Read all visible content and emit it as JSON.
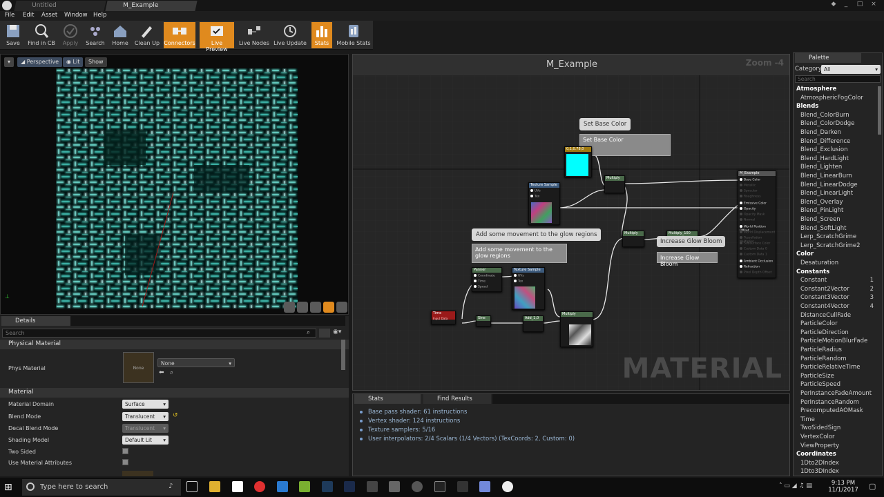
{
  "titlebar": {
    "tabs": [
      "Untitled",
      "M_Example"
    ],
    "controls": [
      "_",
      "□",
      "×"
    ]
  },
  "menu": [
    "File",
    "Edit",
    "Asset",
    "Window",
    "Help"
  ],
  "toolbar": [
    {
      "label": "Save",
      "state": "normal",
      "icon": "save-icon"
    },
    {
      "label": "Find in CB",
      "state": "normal",
      "icon": "find-in-cb-icon"
    },
    {
      "label": "Apply",
      "state": "disabled",
      "icon": "apply-icon"
    },
    {
      "label": "Search",
      "state": "normal",
      "icon": "search-icon"
    },
    {
      "label": "Home",
      "state": "normal",
      "icon": "home-icon"
    },
    {
      "label": "Clean Up",
      "state": "normal",
      "icon": "clean-up-icon"
    },
    {
      "label": "Connectors",
      "state": "active",
      "icon": "connectors-icon"
    },
    {
      "label": "Live Preview",
      "state": "active",
      "icon": "live-preview-icon"
    },
    {
      "label": "Live Nodes",
      "state": "normal",
      "icon": "live-nodes-icon"
    },
    {
      "label": "Live Update",
      "state": "normal",
      "icon": "live-update-icon"
    },
    {
      "label": "Stats",
      "state": "active",
      "icon": "stats-icon"
    },
    {
      "label": "Mobile Stats",
      "state": "normal",
      "icon": "mobile-stats-icon"
    }
  ],
  "viewport": {
    "perspective": "Perspective",
    "lit": "Lit",
    "show": "Show"
  },
  "details": {
    "tab": "Details",
    "search_placeholder": "Search",
    "physical_material_section": "Physical Material",
    "phys_material_label": "Phys Material",
    "phys_material_thumb": "None",
    "phys_material_value": "None",
    "material_section": "Material",
    "props": [
      {
        "label": "Material Domain",
        "value": "Surface",
        "disabled": false
      },
      {
        "label": "Blend Mode",
        "value": "Translucent",
        "disabled": false
      },
      {
        "label": "Decal Blend Mode",
        "value": "Translucent",
        "disabled": true
      },
      {
        "label": "Shading Model",
        "value": "Default Lit",
        "disabled": false
      }
    ],
    "two_sided": "Two Sided",
    "use_material_attributes": "Use Material Attributes"
  },
  "graph": {
    "title": "M_Example",
    "zoom": "Zoom -4",
    "watermark": "MATERIAL",
    "comments": {
      "base_color_bubble": "Set Base Color",
      "base_color_box": "Set Base Color",
      "glow_bubble": "Add some movement to the glow regions",
      "glow_box": "Add some movement to the glow regions",
      "bloom_bubble": "Increase Glow Bloom",
      "bloom_box": "Increase Glow Bloom"
    },
    "nodes": {
      "color_param": "0,1,0.78,0",
      "texture1": "Texture Sample",
      "texture1_pins": [
        "UVs",
        "Tex"
      ],
      "multiply1": "Multiply",
      "multiply2": "Multiply",
      "multiply3": "Multiply_100",
      "multiply4": "Multiply",
      "panner": "Panner",
      "panner_pins": [
        "Coordinate",
        "Time",
        "Speed"
      ],
      "texture2": "Texture Sample",
      "texture2_pins": [
        "UVs",
        "Tex"
      ],
      "time": "Time",
      "time_sub": "Input Data",
      "sine": "Sine",
      "add": "Add_1,0",
      "result": "M_Example",
      "result_pins": [
        "Base Color",
        "Metallic",
        "Specular",
        "Roughness",
        "Emissive Color",
        "Opacity",
        "Opacity Mask",
        "Normal",
        "World Position Offset",
        "World Displacement",
        "Tessellation Multiplier",
        "Subsurface Color",
        "Custom Data 0",
        "Custom Data 1",
        "Ambient Occlusion",
        "Refraction",
        "Pixel Depth Offset"
      ]
    }
  },
  "bottom_tabs": [
    "Stats",
    "Find Results"
  ],
  "stats": [
    "Base pass shader: 61 instructions",
    "Vertex shader: 124 instructions",
    "Texture samplers: 5/16",
    "User interpolators: 2/4 Scalars (1/4 Vectors) (TexCoords: 2, Custom: 0)"
  ],
  "palette": {
    "title": "Palette",
    "category_label": "Category:",
    "category_value": "All",
    "search_placeholder": "Search",
    "entries": [
      {
        "cat": "Atmosphere"
      },
      {
        "item": "AtmosphericFogColor"
      },
      {
        "cat": "Blends"
      },
      {
        "item": "Blend_ColorBurn"
      },
      {
        "item": "Blend_ColorDodge"
      },
      {
        "item": "Blend_Darken"
      },
      {
        "item": "Blend_Difference"
      },
      {
        "item": "Blend_Exclusion"
      },
      {
        "item": "Blend_HardLight"
      },
      {
        "item": "Blend_Lighten"
      },
      {
        "item": "Blend_LinearBurn"
      },
      {
        "item": "Blend_LinearDodge"
      },
      {
        "item": "Blend_LinearLight"
      },
      {
        "item": "Blend_Overlay"
      },
      {
        "item": "Blend_PinLight"
      },
      {
        "item": "Blend_Screen"
      },
      {
        "item": "Blend_SoftLight"
      },
      {
        "item": "Lerp_ScratchGrime"
      },
      {
        "item": "Lerp_ScratchGrime2"
      },
      {
        "cat": "Color"
      },
      {
        "item": "Desaturation"
      },
      {
        "cat": "Constants"
      },
      {
        "item": "Constant",
        "key": "1"
      },
      {
        "item": "Constant2Vector",
        "key": "2"
      },
      {
        "item": "Constant3Vector",
        "key": "3"
      },
      {
        "item": "Constant4Vector",
        "key": "4"
      },
      {
        "item": "DistanceCullFade"
      },
      {
        "item": "ParticleColor"
      },
      {
        "item": "ParticleDirection"
      },
      {
        "item": "ParticleMotionBlurFade"
      },
      {
        "item": "ParticleRadius"
      },
      {
        "item": "ParticleRandom"
      },
      {
        "item": "ParticleRelativeTime"
      },
      {
        "item": "ParticleSize"
      },
      {
        "item": "ParticleSpeed"
      },
      {
        "item": "PerInstanceFadeAmount"
      },
      {
        "item": "PerInstanceRandom"
      },
      {
        "item": "PrecomputedAOMask"
      },
      {
        "item": "Time"
      },
      {
        "item": "TwoSidedSign"
      },
      {
        "item": "VertexColor"
      },
      {
        "item": "ViewProperty"
      },
      {
        "cat": "Coordinates"
      },
      {
        "item": "1Dto2DIndex"
      },
      {
        "item": "1Dto3DIndex"
      }
    ]
  },
  "taskbar": {
    "search_placeholder": "Type here to search",
    "time": "9:13 PM",
    "date": "11/1/2017"
  },
  "colors": {
    "accent": "#e08a1e",
    "cyan": "#00ffff",
    "glow": "#6ffff0"
  }
}
